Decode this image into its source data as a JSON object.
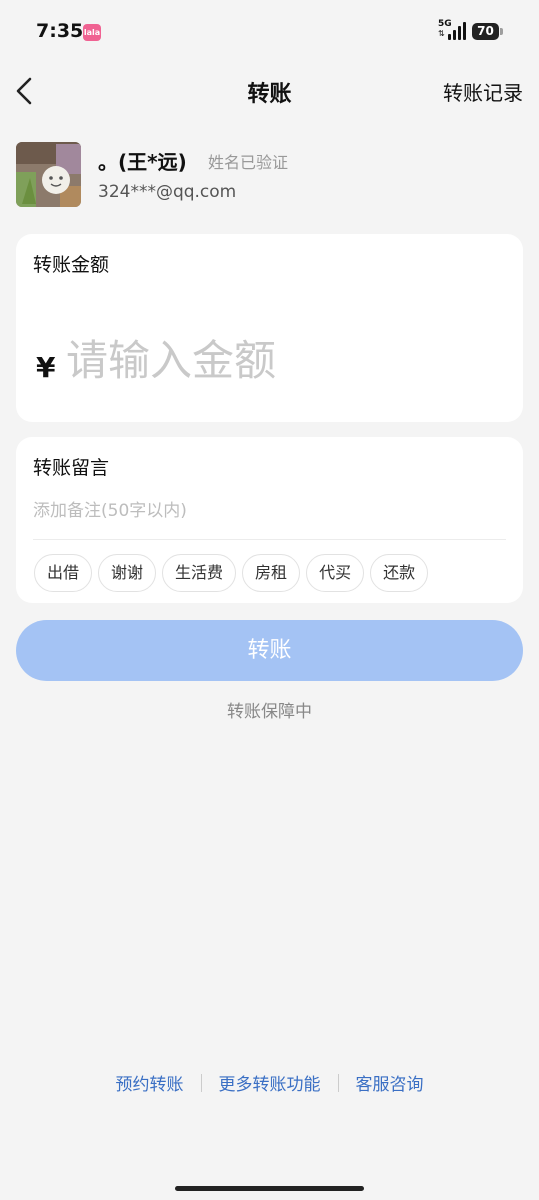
{
  "status_bar": {
    "time": "7:35",
    "network": "5G",
    "battery": "70",
    "app_badge": "lala"
  },
  "nav": {
    "title": "转账",
    "records_link": "转账记录"
  },
  "recipient": {
    "name": "。(王*远)",
    "verified": "姓名已验证",
    "account": "324***@qq.com"
  },
  "amount": {
    "label": "转账金额",
    "currency": "¥",
    "placeholder": "请输入金额"
  },
  "memo": {
    "label": "转账留言",
    "placeholder": "添加备注(50字以内)",
    "chips": [
      "出借",
      "谢谢",
      "生活费",
      "房租",
      "代买",
      "还款"
    ]
  },
  "submit_label": "转账",
  "guarantee_text": "转账保障中",
  "footer": {
    "links": [
      "预约转账",
      "更多转账功能",
      "客服咨询"
    ]
  },
  "colors": {
    "accent": "#a4c3f4",
    "link": "#3a6fc4",
    "background": "#f4f4f4"
  }
}
